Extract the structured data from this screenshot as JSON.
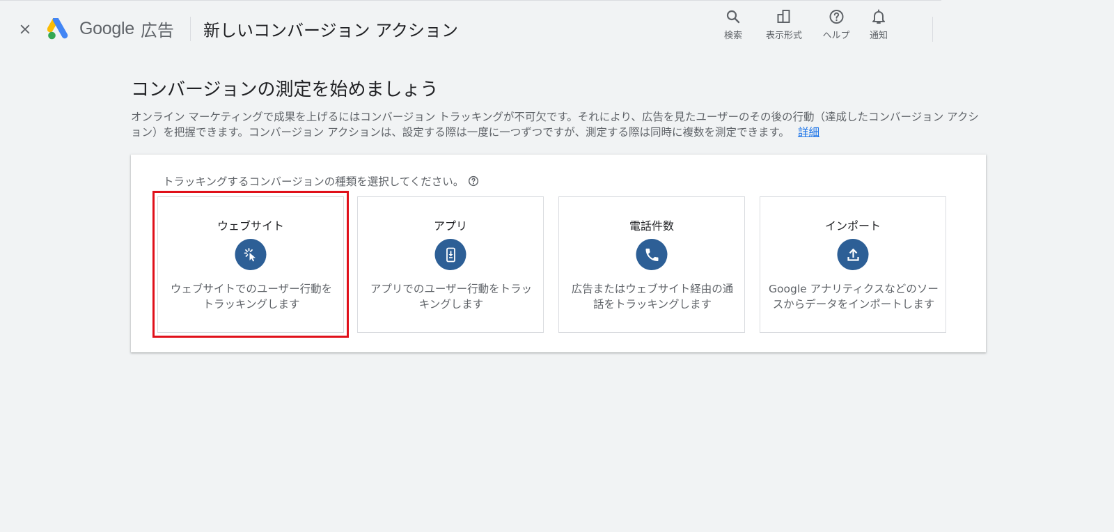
{
  "header": {
    "logo_text": "Google",
    "logo_suffix": "広告",
    "page_title": "新しいコンバージョン アクション",
    "close_icon": "close-icon",
    "tools": [
      {
        "label": "検索",
        "icon": "search-icon"
      },
      {
        "label": "表示形式",
        "icon": "appearance-icon"
      },
      {
        "label": "ヘルプ",
        "icon": "help-icon"
      },
      {
        "label": "通知",
        "icon": "bell-icon"
      }
    ]
  },
  "main": {
    "heading": "コンバージョンの測定を始めましょう",
    "description": "オンライン マーケティングで成果を上げるにはコンバージョン トラッキングが不可欠です。それにより、広告を見たユーザーのその後の行動（達成したコンバージョン アクション）を把握できます。コンバージョン アクションは、設定する際は一度に一つずつですが、測定する際は同時に複数を測定できます。",
    "learn_more": "詳細"
  },
  "card": {
    "prompt": "トラッキングするコンバージョンの種類を選択してください。",
    "options": [
      {
        "title": "ウェブサイト",
        "icon": "cursor-click-icon",
        "description": "ウェブサイトでのユーザー行動をトラッキングします",
        "selected_highlight": true
      },
      {
        "title": "アプリ",
        "icon": "phone-download-icon",
        "description": "アプリでのユーザー行動をトラッキングします"
      },
      {
        "title": "電話件数",
        "icon": "phone-icon",
        "description": "広告またはウェブサイト経由の通話をトラッキングします"
      },
      {
        "title": "インポート",
        "icon": "upload-icon",
        "description": "Google アナリティクスなどのソースからデータをインポートします"
      }
    ]
  },
  "colors": {
    "background": "#f1f3f4",
    "icon_circle": "#2d5f96",
    "link": "#1a73e8",
    "highlight": "#e0101a",
    "logo_yellow": "#fbbc04",
    "logo_blue": "#4285f4",
    "logo_green": "#34a853"
  }
}
